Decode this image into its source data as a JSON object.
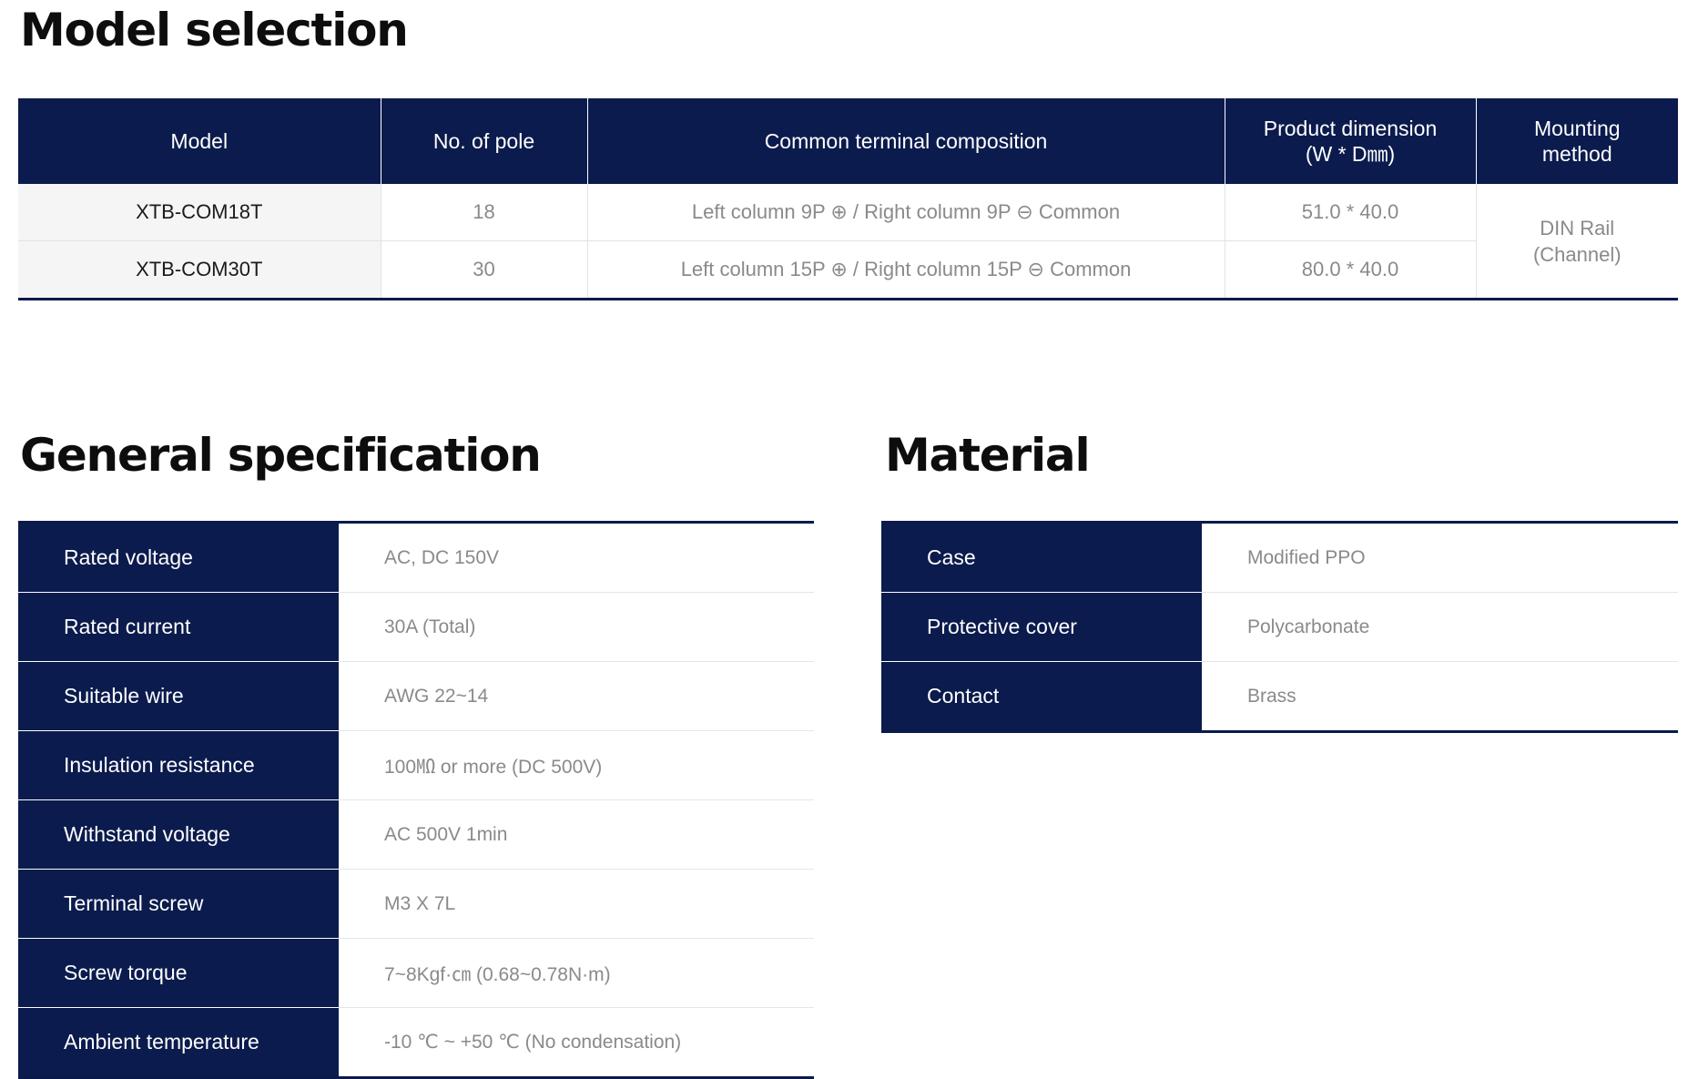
{
  "model_selection": {
    "title": "Model selection",
    "headers": {
      "model": "Model",
      "poles": "No. of pole",
      "composition": "Common terminal composition",
      "dimension_line1": "Product dimension",
      "dimension_line2": "(W * D㎜)",
      "mounting_line1": "Mounting",
      "mounting_line2": "method"
    },
    "rows": [
      {
        "model": "XTB-COM18T",
        "poles": "18",
        "composition": "Left column 9P ⊕ / Right column 9P ⊖ Common",
        "dimension": "51.0 * 40.0"
      },
      {
        "model": "XTB-COM30T",
        "poles": "30",
        "composition": "Left column 15P ⊕ / Right column 15P ⊖ Common",
        "dimension": "80.0 * 40.0"
      }
    ],
    "mounting_line1": "DIN Rail",
    "mounting_line2": "(Channel)"
  },
  "general_specification": {
    "title": "General specification",
    "rows": [
      {
        "label": "Rated voltage",
        "value": "AC, DC 150V"
      },
      {
        "label": "Rated current",
        "value": "30A (Total)"
      },
      {
        "label": "Suitable wire",
        "value": "AWG 22~14"
      },
      {
        "label": "Insulation resistance",
        "value": "100㏁ or more (DC 500V)"
      },
      {
        "label": "Withstand voltage",
        "value": "AC 500V 1min"
      },
      {
        "label": "Terminal screw",
        "value": "M3 X 7L"
      },
      {
        "label": "Screw torque",
        "value": "7~8Kgf·㎝ (0.68~0.78N·m)"
      },
      {
        "label": "Ambient temperature",
        "value": "-10 ℃ ~ +50 ℃ (No condensation)"
      }
    ]
  },
  "material": {
    "title": "Material",
    "rows": [
      {
        "label": "Case",
        "value": "Modified PPO"
      },
      {
        "label": "Protective cover",
        "value": "Polycarbonate"
      },
      {
        "label": "Contact",
        "value": "Brass"
      }
    ]
  }
}
